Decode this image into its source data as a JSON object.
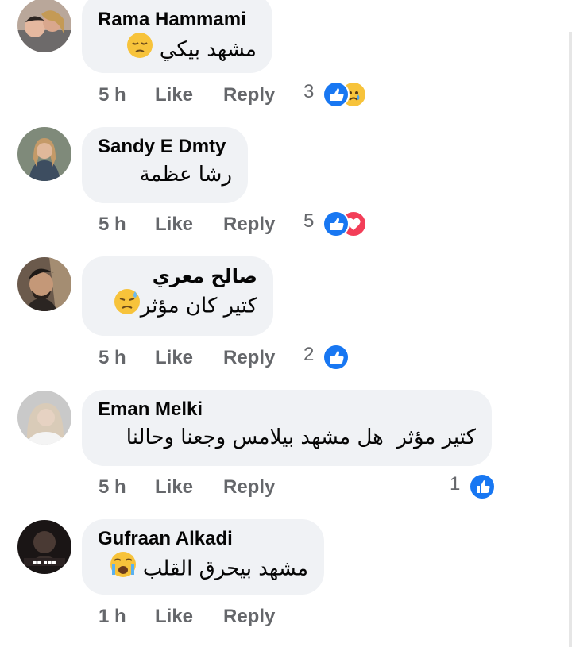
{
  "comments": [
    {
      "author": "Rama Hammami",
      "text": "مشهد بيكي",
      "time": "5 h",
      "like_label": "Like",
      "reply_label": "Reply",
      "reaction_count": "3",
      "reactions": [
        "like-icon",
        "sad-icon"
      ],
      "trailing_emoji": "pensive-face-emoji"
    },
    {
      "author": "Sandy E Dmty",
      "text": "رشا عظمة",
      "time": "5 h",
      "like_label": "Like",
      "reply_label": "Reply",
      "reaction_count": "5",
      "reactions": [
        "like-icon",
        "love-icon"
      ]
    },
    {
      "author": "صالح معري",
      "text": "كتير كان مؤثر",
      "time": "5 h",
      "like_label": "Like",
      "reply_label": "Reply",
      "reaction_count": "2",
      "reactions": [
        "like-icon"
      ],
      "trailing_emoji": "downcast-sweat-face-emoji"
    },
    {
      "author": "Eman Melki",
      "text": "كتير مؤثر  هل مشهد بيلامس وجعنا وحالنا",
      "time": "5 h",
      "like_label": "Like",
      "reply_label": "Reply",
      "reaction_count": "1",
      "reactions": [
        "like-icon"
      ]
    },
    {
      "author": "Gufraan Alkadi",
      "text": "مشهد بيحرق القلب",
      "time": "1 h",
      "like_label": "Like",
      "reply_label": "Reply",
      "trailing_emoji": "crying-face-emoji"
    }
  ],
  "colors": {
    "bubble": "#f0f2f5",
    "meta_text": "#65676b",
    "like_blue": "#1877f2",
    "love_red": "#f33e58",
    "sad_yellow": "#f7c33b"
  }
}
